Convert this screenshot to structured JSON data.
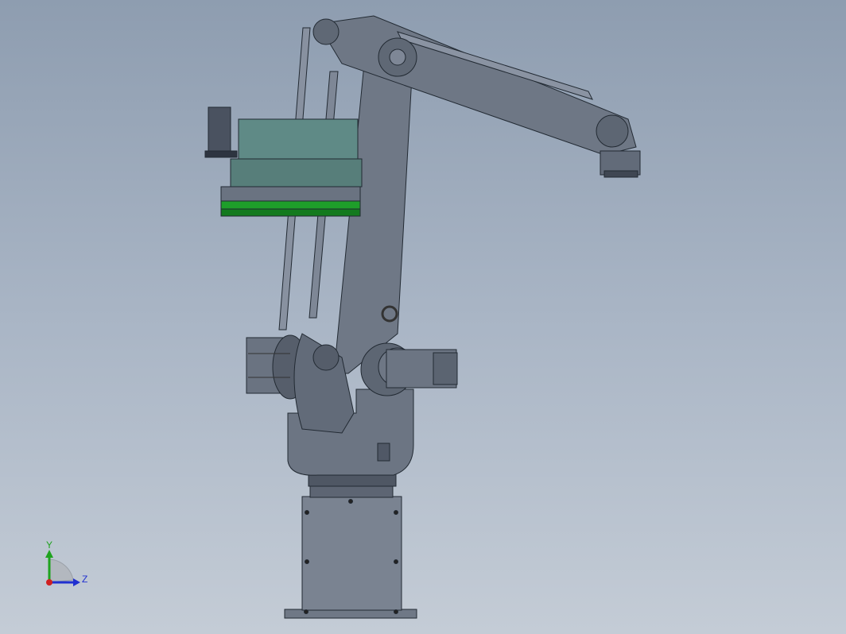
{
  "viewport": {
    "background_top": "#8e9db0",
    "background_bottom": "#c4ccd6"
  },
  "model": {
    "body_color": "#6d7684",
    "body_dark": "#4d5562",
    "gripper_color": "#5f8a86",
    "pad_color": "#1e9e2a"
  },
  "triad": {
    "y_label": "Y",
    "z_label": "Z",
    "y_color": "#1fa31f",
    "z_color": "#2030d0"
  }
}
